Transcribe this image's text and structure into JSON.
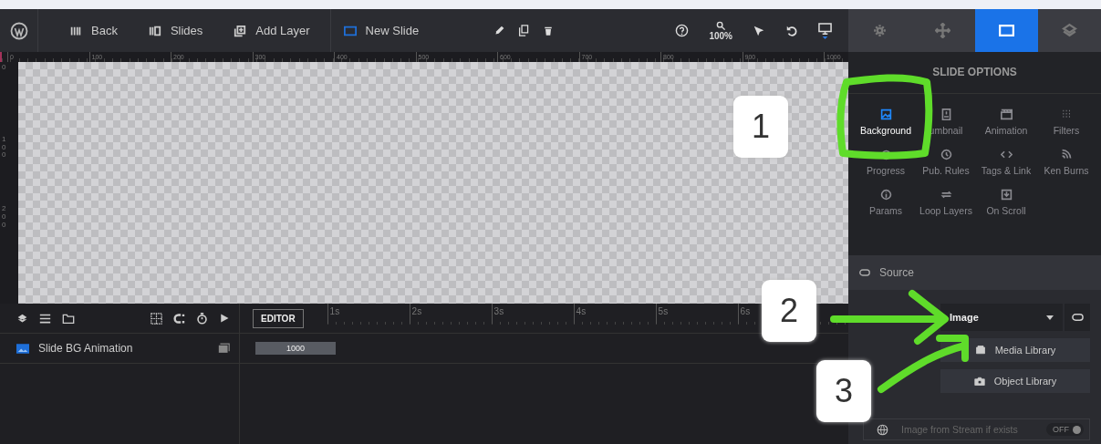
{
  "toolbar": {
    "items": [
      {
        "kind": "back",
        "label": "Back",
        "selected": false
      },
      {
        "kind": "slides",
        "label": "Slides",
        "selected": false
      },
      {
        "kind": "add",
        "label": "Add Layer",
        "selected": false
      },
      {
        "kind": "slide",
        "label": "New Slide",
        "selected": true
      }
    ],
    "zoom": "100%"
  },
  "ruler": {
    "marks": [
      "0",
      "100",
      "200",
      "300",
      "400",
      "500",
      "600",
      "700",
      "800",
      "900",
      "1000"
    ],
    "vertical_marks": [
      "0",
      "100",
      "200"
    ]
  },
  "panel_tabs": [
    {
      "kind": "settings",
      "selected": false
    },
    {
      "kind": "move",
      "selected": false
    },
    {
      "kind": "slide",
      "selected": true
    },
    {
      "kind": "layers",
      "selected": false
    }
  ],
  "slide_options": {
    "title": "SLIDE OPTIONS",
    "items": [
      {
        "kind": "background",
        "label": "Background",
        "selected": true
      },
      {
        "kind": "thumbnail",
        "label": "umbnail",
        "selected": false
      },
      {
        "kind": "animation",
        "label": "Animation",
        "selected": false
      },
      {
        "kind": "filters",
        "label": "Filters",
        "selected": false
      },
      {
        "kind": "progress",
        "label": "Progress",
        "selected": false
      },
      {
        "kind": "rules",
        "label": "Pub. Rules",
        "selected": false
      },
      {
        "kind": "tags",
        "label": "Tags & Link",
        "selected": false
      },
      {
        "kind": "kenburns",
        "label": "Ken Burns",
        "selected": false
      },
      {
        "kind": "params",
        "label": "Params",
        "selected": false
      },
      {
        "kind": "loop",
        "label": "Loop Layers",
        "selected": false
      },
      {
        "kind": "scroll",
        "label": "On Scroll",
        "selected": false
      }
    ]
  },
  "source": {
    "title": "Source",
    "type": "Image",
    "buttons": [
      {
        "kind": "media",
        "label": "Media Library"
      },
      {
        "kind": "object",
        "label": "Object Library"
      }
    ],
    "stream": {
      "label": "Image from Stream if exists",
      "toggle": "OFF",
      "on": false
    }
  },
  "timeline": {
    "mode": "EDITOR",
    "ticks": [
      "1s",
      "2s",
      "3s",
      "4s",
      "5s",
      "6s"
    ],
    "layers": [
      {
        "name": "Slide BG Animation",
        "duration": "1000"
      }
    ]
  },
  "annotations": [
    {
      "label": "1"
    },
    {
      "label": "2"
    },
    {
      "label": "3"
    }
  ]
}
